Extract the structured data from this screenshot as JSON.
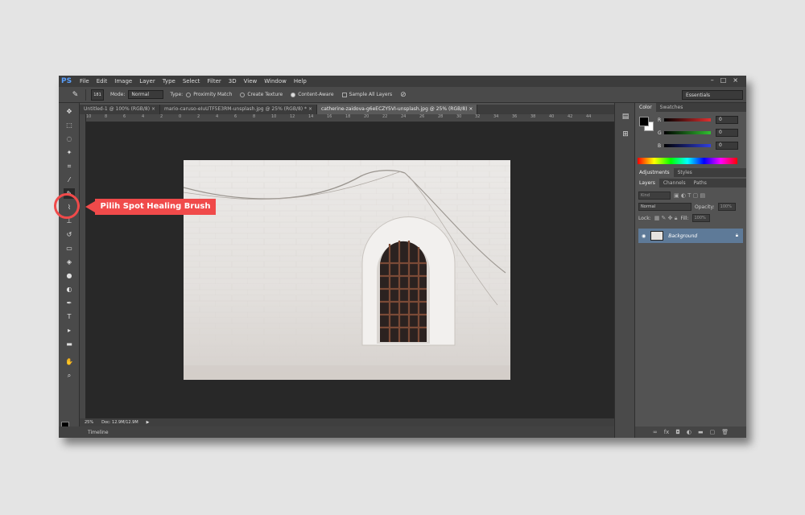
{
  "app": {
    "logo": "PS",
    "menu": [
      "File",
      "Edit",
      "Image",
      "Layer",
      "Type",
      "Select",
      "Filter",
      "3D",
      "View",
      "Window",
      "Help"
    ],
    "window_controls": [
      "–",
      "□",
      "×"
    ]
  },
  "options_bar": {
    "brush_size": "181",
    "mode_label": "Mode:",
    "mode_value": "Normal",
    "type_label": "Type:",
    "type_options": [
      "Proximity Match",
      "Create Texture",
      "Content-Aware"
    ],
    "sample_all_layers": "Sample All Layers",
    "workspace": "Essentials"
  },
  "documents": {
    "tabs": [
      "Untitled-1 @ 100% (RGB/8) ×",
      "mario-caruso-eIuUTF5E3RM-unsplash.jpg @ 25% (RGB/8) * ×",
      "catherine-zaidova-g6eECZY5VI-unsplash.jpg @ 25% (RGB/8) ×"
    ],
    "ruler_ticks": [
      "10",
      "8",
      "6",
      "4",
      "2",
      "0",
      "2",
      "4",
      "6",
      "8",
      "10",
      "12",
      "14",
      "16",
      "18",
      "20",
      "22",
      "24",
      "26",
      "28",
      "30",
      "32",
      "34",
      "36",
      "38",
      "40",
      "42",
      "44"
    ]
  },
  "status": {
    "zoom": "25%",
    "doc": "Doc: 12.9M/12.9M",
    "timeline": "Timeline"
  },
  "panels": {
    "color_tabs": [
      "Color",
      "Swatches"
    ],
    "channels": [
      {
        "label": "R",
        "value": "0",
        "color": "#e03030"
      },
      {
        "label": "G",
        "value": "0",
        "color": "#30c030"
      },
      {
        "label": "B",
        "value": "0",
        "color": "#3040e0"
      }
    ],
    "adjust_tabs": [
      "Adjustments",
      "Styles"
    ],
    "layer_tabs": [
      "Layers",
      "Channels",
      "Paths"
    ],
    "kind_label": "Kind",
    "blend_mode": "Normal",
    "opacity_label": "Opacity:",
    "opacity_value": "100%",
    "lock_label": "Lock:",
    "fill_label": "Fill:",
    "fill_value": "100%",
    "layer_name": "Background"
  },
  "callout": {
    "text": "Pilih Spot Healing Brush",
    "color": "#f04a4a"
  }
}
